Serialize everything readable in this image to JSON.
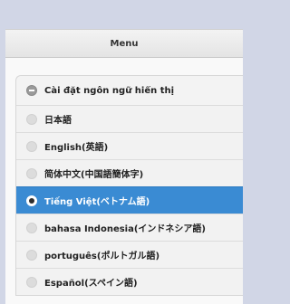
{
  "header": {
    "title": "Menu"
  },
  "language_group": {
    "label": "Cài đặt ngôn ngữ hiển thị",
    "icon": "minus-circle-icon"
  },
  "options": [
    {
      "label": "日本語",
      "selected": false
    },
    {
      "label": "English(英語)",
      "selected": false
    },
    {
      "label": "简体中文(中国語簡体字)",
      "selected": false
    },
    {
      "label": "Tiếng Việt(ベトナム語)",
      "selected": true
    },
    {
      "label": "bahasa Indonesia(インドネシア語)",
      "selected": false
    },
    {
      "label": "português(ポルトガル語)",
      "selected": false
    },
    {
      "label": "Español(スペイン語)",
      "selected": false
    }
  ],
  "colors": {
    "background": "#d1d6e6",
    "selected_row": "#3a8bd3"
  }
}
